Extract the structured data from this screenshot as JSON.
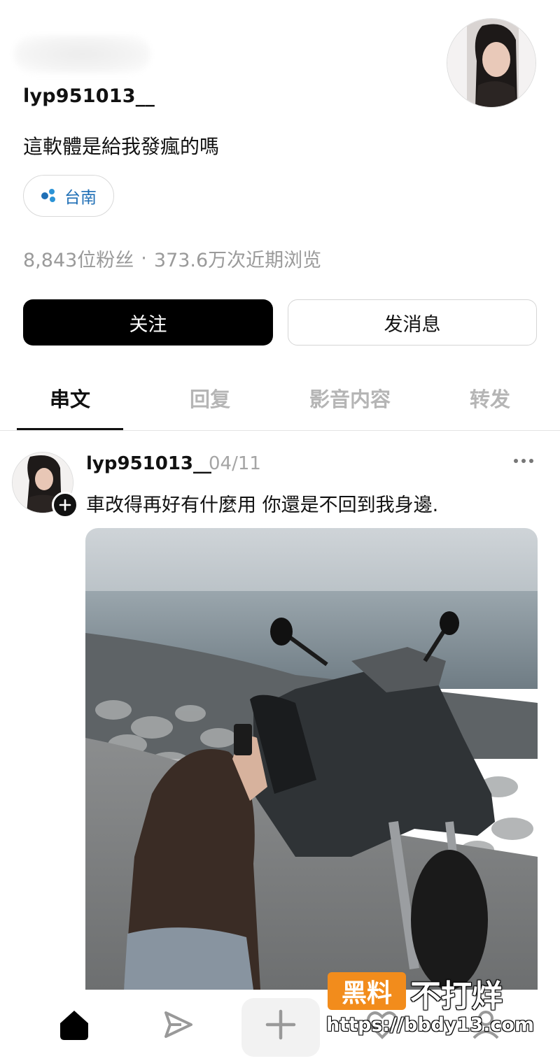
{
  "profile": {
    "username": "lyp951013__",
    "bio": "這軟體是給我發瘋的嗎",
    "location": "台南",
    "followers": "8,843位粉丝",
    "separator": "·",
    "views": "373.6万次近期浏览"
  },
  "actions": {
    "follow_label": "关注",
    "message_label": "发消息"
  },
  "tabs": [
    {
      "label": "串文",
      "active": true
    },
    {
      "label": "回复",
      "active": false
    },
    {
      "label": "影音内容",
      "active": false
    },
    {
      "label": "转发",
      "active": false
    }
  ],
  "post": {
    "username": "lyp951013__",
    "date": "04/11",
    "text": "車改得再好有什麼用 你還是不回到我身邊."
  },
  "watermark": {
    "badge": "黑料",
    "title": "不打烊",
    "url": "https://bbdy13.com"
  },
  "bottom_nav": [
    "home-icon",
    "send-icon",
    "plus-icon",
    "heart-icon",
    "profile-icon"
  ],
  "colors": {
    "primary": "#000000",
    "location_text": "#1f6fb6",
    "muted": "#9a9a9a",
    "watermark": "#f28c1c"
  }
}
